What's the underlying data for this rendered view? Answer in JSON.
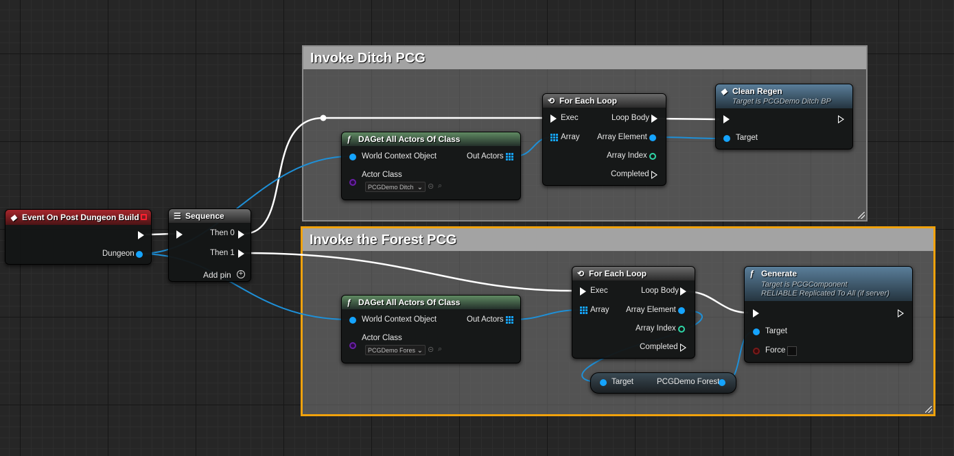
{
  "colors": {
    "exec_wire": "#ffffff",
    "object_wire": "#15a4ff",
    "selection_outline": "#f1a20c",
    "event_header": "#a8262c",
    "function_header_green": "#5f8a62",
    "function_header_blue": "#5a7e9a"
  },
  "comments": {
    "ditch": {
      "title": "Invoke Ditch PCG"
    },
    "forest": {
      "title": "Invoke the Forest PCG"
    }
  },
  "event_node": {
    "title": "Event On Post Dungeon Build",
    "icon": "event-diamond-icon",
    "pins": {
      "dungeon": "Dungeon"
    }
  },
  "sequence_node": {
    "title": "Sequence",
    "icon": "sequence-icon",
    "pins": {
      "then0": "Then 0",
      "then1": "Then 1",
      "add_pin": "Add pin"
    }
  },
  "daget_ditch": {
    "title": "DAGet All Actors Of Class",
    "icon": "function-icon",
    "pins": {
      "world_context": "World Context Object",
      "out_actors": "Out Actors",
      "actor_class": "Actor Class"
    },
    "actor_class_value": "PCGDemo Ditch"
  },
  "daget_forest": {
    "title": "DAGet All Actors Of Class",
    "icon": "function-icon",
    "pins": {
      "world_context": "World Context Object",
      "out_actors": "Out Actors",
      "actor_class": "Actor Class"
    },
    "actor_class_value": "PCGDemo Fores"
  },
  "foreach_ditch": {
    "title": "For Each Loop",
    "icon": "loop-icon",
    "pins": {
      "exec": "Exec",
      "loop_body": "Loop Body",
      "array": "Array",
      "array_element": "Array Element",
      "array_index": "Array Index",
      "completed": "Completed"
    }
  },
  "foreach_forest": {
    "title": "For Each Loop",
    "icon": "loop-icon",
    "pins": {
      "exec": "Exec",
      "loop_body": "Loop Body",
      "array": "Array",
      "array_element": "Array Element",
      "array_index": "Array Index",
      "completed": "Completed"
    }
  },
  "clean_regen": {
    "title": "Clean Regen",
    "subtitle": "Target is PCGDemo Ditch BP",
    "icon": "event-diamond-icon",
    "pins": {
      "target": "Target"
    }
  },
  "generate": {
    "title": "Generate",
    "subtitle1": "Target is PCGComponent",
    "subtitle2": "RELIABLE Replicated To All (if server)",
    "icon": "function-icon",
    "pins": {
      "target": "Target",
      "force": "Force"
    }
  },
  "cast_node": {
    "pins": {
      "target": "Target",
      "output": "PCGDemo Forest"
    }
  }
}
